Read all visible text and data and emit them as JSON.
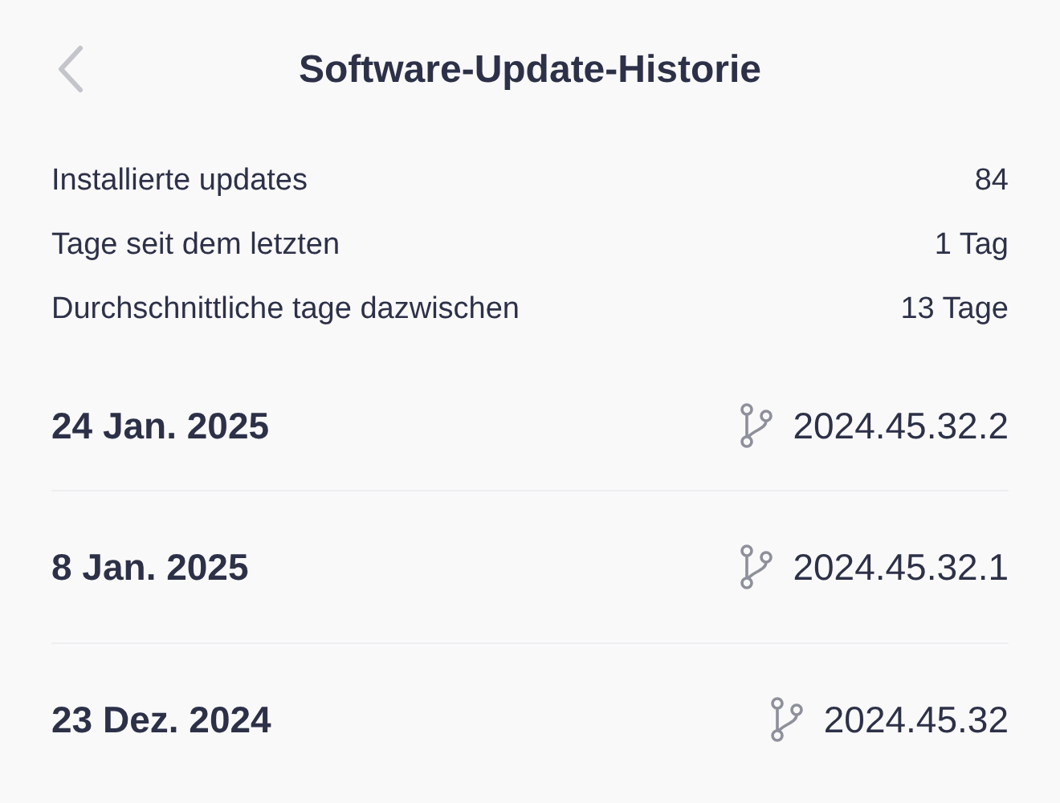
{
  "header": {
    "title": "Software-Update-Historie"
  },
  "stats": [
    {
      "label": "Installierte updates",
      "value": "84"
    },
    {
      "label": "Tage seit dem letzten",
      "value": "1 Tag"
    },
    {
      "label": "Durchschnittliche tage dazwischen",
      "value": "13 Tage"
    }
  ],
  "updates": [
    {
      "date": "24 Jan. 2025",
      "version": "2024.45.32.2"
    },
    {
      "date": "8 Jan. 2025",
      "version": "2024.45.32.1"
    },
    {
      "date": "23 Dez. 2024",
      "version": "2024.45.32"
    }
  ]
}
